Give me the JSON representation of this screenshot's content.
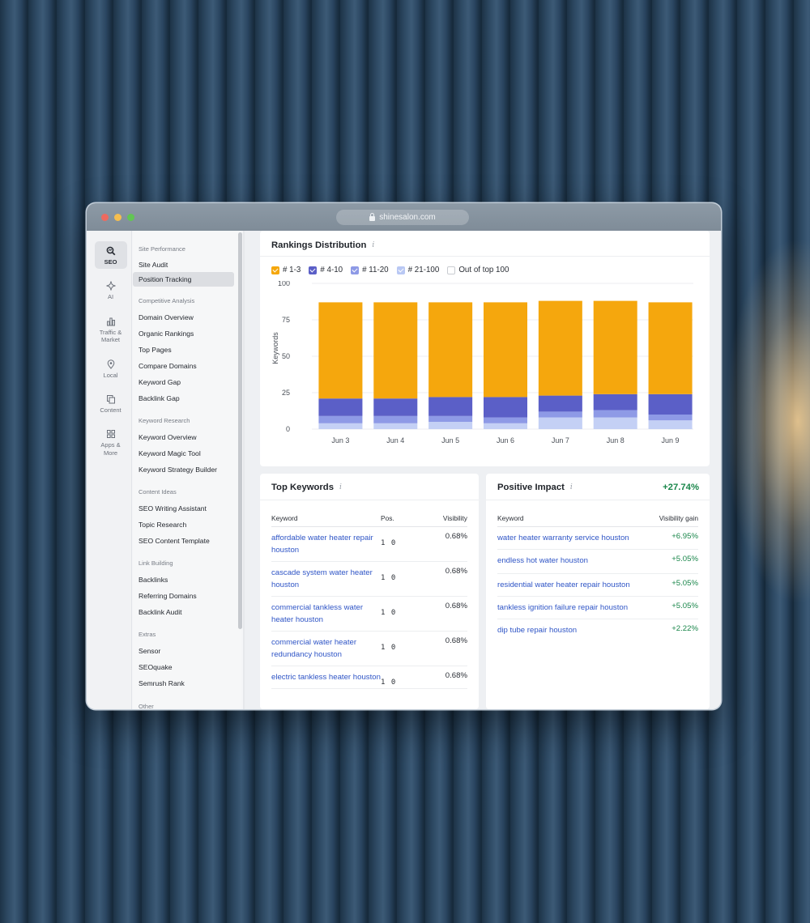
{
  "browser": {
    "url": "shinesalon.com"
  },
  "rail": [
    {
      "label": "SEO",
      "icon": "seo-icon",
      "active": true
    },
    {
      "label": "AI",
      "icon": "ai-icon"
    },
    {
      "label": "Traffic & Market",
      "icon": "traffic-icon"
    },
    {
      "label": "Local",
      "icon": "location-pin-icon"
    },
    {
      "label": "Content",
      "icon": "content-icon"
    },
    {
      "label": "Apps & More",
      "icon": "apps-grid-icon"
    }
  ],
  "nav": {
    "sections": [
      {
        "title": "Site Performance",
        "items": [
          "Site Audit",
          "Position Tracking"
        ]
      },
      {
        "title": "Competitive Analysis",
        "items": [
          "Domain Overview",
          "Organic Rankings",
          "Top Pages",
          "Compare Domains",
          "Keyword Gap",
          "Backlink Gap"
        ]
      },
      {
        "title": "Keyword Research",
        "items": [
          "Keyword Overview",
          "Keyword Magic Tool",
          "Keyword Strategy Builder"
        ]
      },
      {
        "title": "Content Ideas",
        "items": [
          "SEO Writing Assistant",
          "Topic Research",
          "SEO Content Template"
        ]
      },
      {
        "title": "Link Building",
        "items": [
          "Backlinks",
          "Referring Domains",
          "Backlink Audit"
        ]
      },
      {
        "title": "Extras",
        "items": [
          "Sensor",
          "SEOquake",
          "Semrush Rank"
        ]
      },
      {
        "title": "Other",
        "items": []
      }
    ],
    "active_item": "Position Tracking"
  },
  "rankings": {
    "title": "Rankings Distribution",
    "info_icon": "i",
    "legend": [
      {
        "label": "# 1-3",
        "color": "#f5a70d",
        "checked": true
      },
      {
        "label": "# 4-10",
        "color": "#5b5fc7",
        "checked": true
      },
      {
        "label": "# 11-20",
        "color": "#8e9ae6",
        "checked": true
      },
      {
        "label": "# 21-100",
        "color": "#c4d0f5",
        "checked": true
      },
      {
        "label": "Out of top 100",
        "color": "#ffffff",
        "checked": false
      }
    ]
  },
  "chart_data": {
    "type": "bar",
    "stacked": true,
    "categories": [
      "Jun 3",
      "Jun 4",
      "Jun 5",
      "Jun 6",
      "Jun 7",
      "Jun 8",
      "Jun 9"
    ],
    "series": [
      {
        "name": "# 21-100",
        "color": "#c4d0f5",
        "values": [
          4,
          4,
          5,
          4,
          8,
          8,
          6
        ]
      },
      {
        "name": "# 11-20",
        "color": "#8e9ae6",
        "values": [
          5,
          5,
          4,
          4,
          4,
          5,
          4
        ]
      },
      {
        "name": "# 4-10",
        "color": "#5b5fc7",
        "values": [
          12,
          12,
          13,
          14,
          11,
          11,
          14
        ]
      },
      {
        "name": "# 1-3",
        "color": "#f5a70d",
        "values": [
          66,
          66,
          65,
          65,
          65,
          64,
          63
        ]
      }
    ],
    "ylabel": "Keywords",
    "ylim": [
      0,
      100
    ],
    "yticks": [
      0,
      25,
      50,
      75,
      100
    ],
    "grid": true
  },
  "top_keywords": {
    "title": "Top Keywords",
    "info_icon": "i",
    "columns": [
      "Keyword",
      "Pos.",
      "Visibility"
    ],
    "rows": [
      {
        "keyword": "affordable water heater repair houston",
        "pos": "1 0",
        "visibility": "0.68%"
      },
      {
        "keyword": "cascade system water heater houston",
        "pos": "1 0",
        "visibility": "0.68%"
      },
      {
        "keyword": "commercial tankless water heater houston",
        "pos": "1 0",
        "visibility": "0.68%"
      },
      {
        "keyword": "commercial water heater redundancy houston",
        "pos": "1 0",
        "visibility": "0.68%"
      },
      {
        "keyword": "electric tankless heater houston",
        "pos": "1 0",
        "visibility": "0.68%"
      }
    ]
  },
  "positive_impact": {
    "title": "Positive Impact",
    "info_icon": "i",
    "total": "+27.74%",
    "columns": [
      "Keyword",
      "Visibility gain"
    ],
    "rows": [
      {
        "keyword": "water heater warranty service houston",
        "gain": "+6.95%"
      },
      {
        "keyword": "endless hot water houston",
        "gain": "+5.05%"
      },
      {
        "keyword": "residential water heater repair houston",
        "gain": "+5.05%"
      },
      {
        "keyword": "tankless ignition failure repair houston",
        "gain": "+5.05%"
      },
      {
        "keyword": "dip tube repair houston",
        "gain": "+2.22%"
      }
    ]
  }
}
